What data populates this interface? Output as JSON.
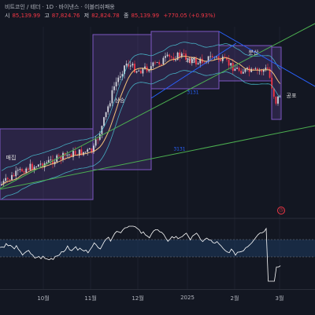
{
  "header": {
    "title": "비트코인 / 테더 · 1D · 바이낸스 · 이블리쉬패옹",
    "ohlc": [
      {
        "label": "시",
        "value": "85,139.99"
      },
      {
        "label": "고",
        "value": "87,824.76"
      },
      {
        "label": "저",
        "value": "82,824.78"
      },
      {
        "label": "종",
        "value": "85,139.99"
      }
    ],
    "change": "+770.05 (+0.93%)"
  },
  "zones": [
    {
      "label": "매집"
    },
    {
      "label": "상승"
    },
    {
      "label": "과잉"
    },
    {
      "label": "분산"
    },
    {
      "label": "공포"
    }
  ],
  "trend_labels": {
    "upper": "3131",
    "lower": "3131"
  },
  "xaxis": {
    "labels": [
      "10월",
      "11월",
      "12월",
      "2025",
      "2월",
      "3월"
    ]
  },
  "colors": {
    "up": "#d1d4dc",
    "down": "#f23645",
    "zone_fill": "#7e57c2",
    "trend_green": "#4caf50",
    "trend_blue": "#2962ff",
    "rsi": "#ffffff",
    "rsi_band": "#1e3a5f"
  },
  "icons": {
    "alert": "clock-icon"
  }
}
